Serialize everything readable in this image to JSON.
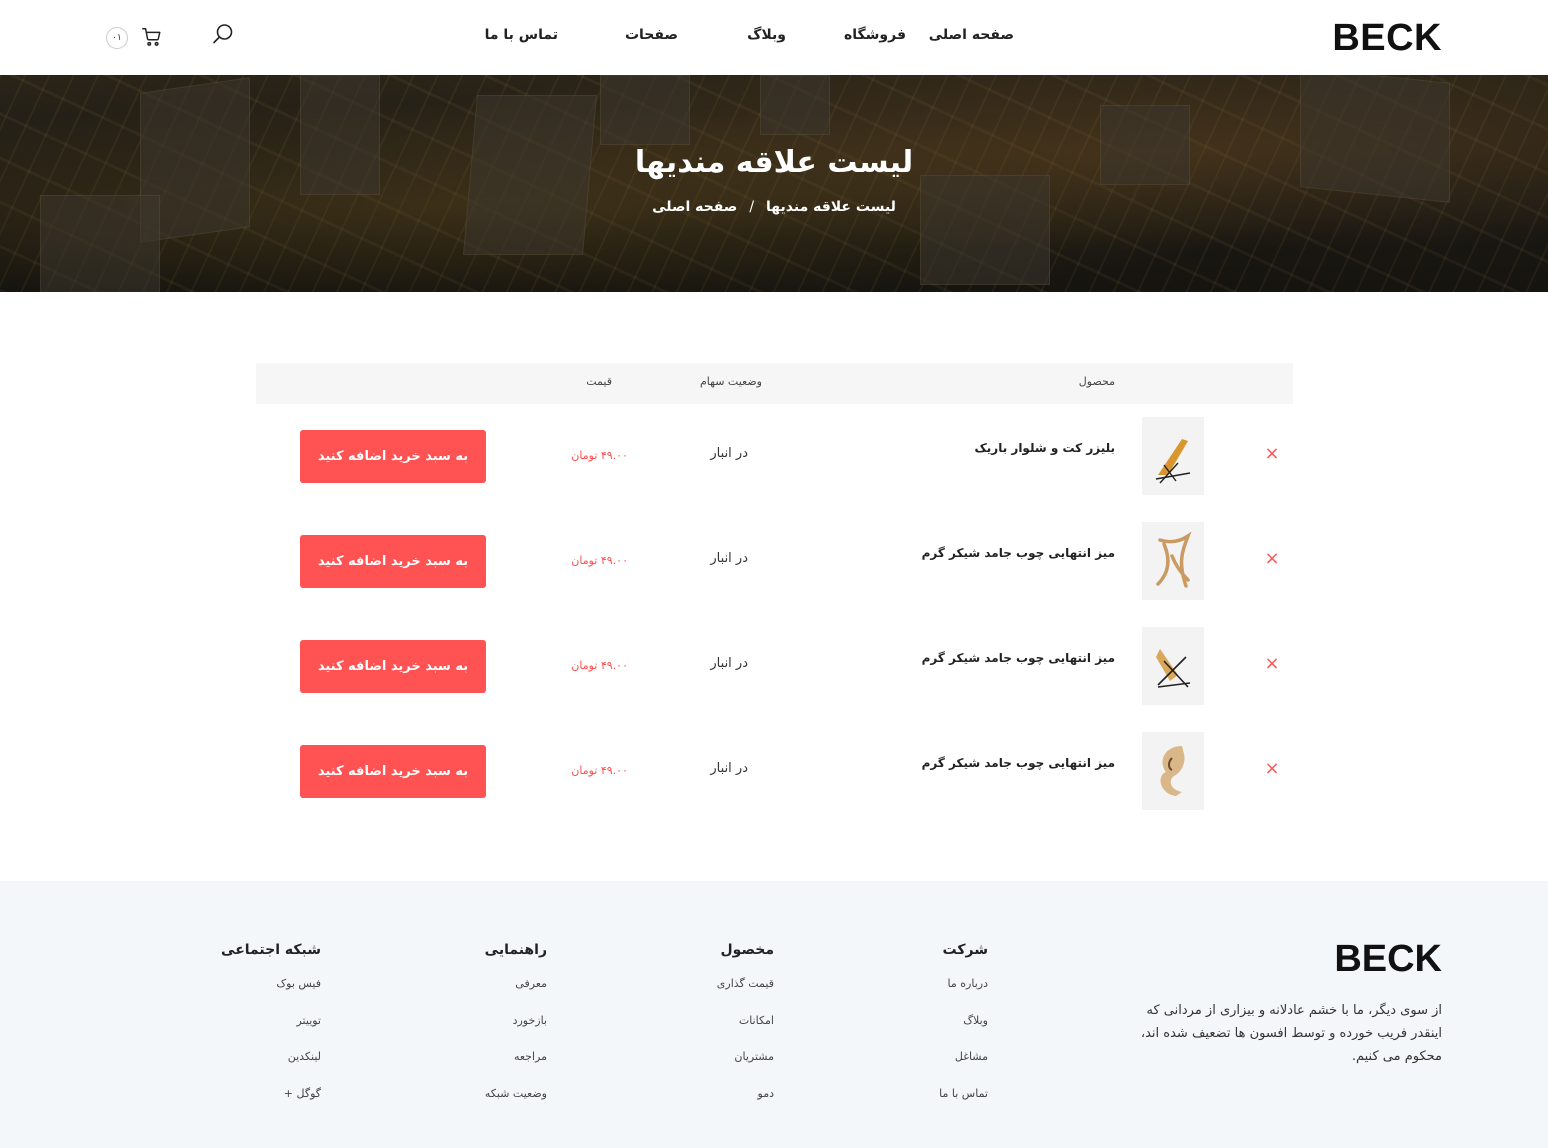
{
  "brand": {
    "logo": "BECK"
  },
  "header": {
    "nav": [
      "صفحه اصلی",
      "فروشگاه",
      "وبلاگ",
      "صفحات",
      "تماس با ما"
    ],
    "cart_count": "۰۱"
  },
  "hero": {
    "title": "لیست علاقه مندیها",
    "breadcrumb_home": "صفحه اصلی",
    "breadcrumb_sep": "/",
    "breadcrumb_current": "لیست علاقه مندیها"
  },
  "table": {
    "headers": {
      "product": "محصول",
      "stock": "وضعیت سهام",
      "price": "قیمت"
    },
    "remove_symbol": "×",
    "rows": [
      {
        "name": "بلیزر کت و شلوار باریک",
        "stock": "در انبار",
        "price": "۴۹.۰۰ تومان",
        "button": "به سبد خرید اضافه کنید",
        "thumb_icon": "lounge-chair-icon"
      },
      {
        "name": "میز انتهایی چوب جامد شیکر گرم",
        "stock": "در انبار",
        "price": "۴۹.۰۰ تومان",
        "button": "به سبد خرید اضافه کنید",
        "thumb_icon": "wooden-stool-icon"
      },
      {
        "name": "میز انتهایی چوب جامد شیکر گرم",
        "stock": "در انبار",
        "price": "۴۹.۰۰ تومان",
        "button": "به سبد خرید اضافه کنید",
        "thumb_icon": "folding-chair-icon"
      },
      {
        "name": "میز انتهایی چوب جامد شیکر گرم",
        "stock": "در انبار",
        "price": "۴۹.۰۰ تومان",
        "button": "به سبد خرید اضافه کنید",
        "thumb_icon": "curved-wood-chair-icon"
      }
    ]
  },
  "footer": {
    "logo": "BECK",
    "about": "از سوی دیگر، ما با خشم عادلانه و بیزاری از مردانی که اینقدر فریب خورده و توسط افسون ها تضعیف شده اند، محکوم می کنیم.",
    "columns": [
      {
        "title": "شرکت",
        "links": [
          "درباره ما",
          "وبلاگ",
          "مشاغل",
          "تماس با ما"
        ]
      },
      {
        "title": "مخصول",
        "links": [
          "قیمت گذاری",
          "امکانات",
          "مشتریان",
          "دمو"
        ]
      },
      {
        "title": "راهنمایی",
        "links": [
          "معرفی",
          "بازخورد",
          "مراجعه",
          "وضعیت شبکه"
        ]
      },
      {
        "title": "شبکه اجتماعی",
        "links": [
          "فیس بوک",
          "توییتر",
          "لینکدین",
          "گوگل +"
        ]
      }
    ]
  },
  "colors": {
    "accent": "#ff5252",
    "price": "#ff4f4f",
    "footer_bg": "#f4f7fa"
  }
}
